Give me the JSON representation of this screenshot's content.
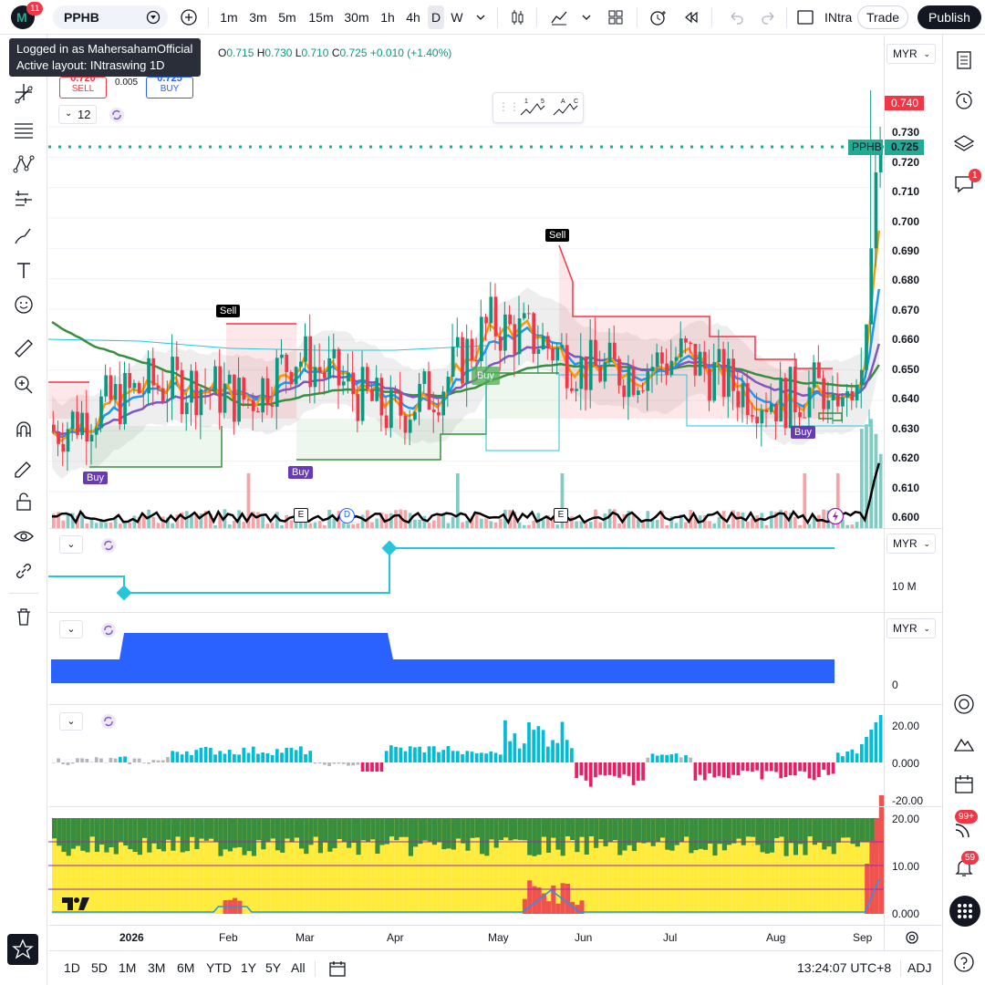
{
  "topbar": {
    "notif_count": "11",
    "symbol": "PPHB",
    "intervals": [
      "1m",
      "3m",
      "5m",
      "15m",
      "30m",
      "1h",
      "4h",
      "D",
      "W"
    ],
    "layout_name": "INtra",
    "trade_label": "Trade",
    "publish_label": "Publish"
  },
  "tooltip": {
    "line1": "Logged in as MahersahamOfficial",
    "line2": "Active layout: INtraswing 1D"
  },
  "legend": {
    "o_label": "O",
    "o_val": "0.715",
    "h_label": "H",
    "h_val": "0.730",
    "l_label": "L",
    "l_val": "0.710",
    "c_label": "C",
    "c_val": "0.725",
    "change": "+0.010 (+1.40%)",
    "sell_price": "0.720",
    "sell_label": "SELL",
    "spread": "0.005",
    "buy_price": "0.725",
    "buy_label": "BUY",
    "indicator_count": "12"
  },
  "main_pane": {
    "currency": "MYR",
    "price_axis": [
      "0.730",
      "0.720",
      "0.710",
      "0.700",
      "0.690",
      "0.680",
      "0.670",
      "0.660",
      "0.650",
      "0.640",
      "0.630",
      "0.620",
      "0.610",
      "0.600"
    ],
    "high_marker": "0.740",
    "symbol_tag": "PPHB",
    "last_price": "0.725",
    "signals": {
      "sell1": "Sell",
      "sell2": "Sell",
      "buy1": "Buy",
      "buy2": "Buy",
      "buy3": "Buy",
      "buy4": "Buy"
    },
    "event_markers": [
      "E",
      "D",
      "E"
    ],
    "elliott_labels": {
      "a": "1",
      "b": "5",
      "c": "A",
      "d": "C"
    }
  },
  "pane2": {
    "currency": "MYR",
    "axis": [
      "10 M"
    ]
  },
  "pane3": {
    "currency": "MYR",
    "axis": [
      "0"
    ]
  },
  "pane4": {
    "axis": [
      "20.00",
      "0.000",
      "-20.00"
    ]
  },
  "pane5": {
    "axis": [
      "20.00",
      "10.00",
      "0.000"
    ]
  },
  "time_axis": [
    "2026",
    "Feb",
    "Mar",
    "Apr",
    "May",
    "Jun",
    "Jul",
    "Aug",
    "Sep"
  ],
  "bottombar": {
    "ranges": [
      "1D",
      "5D",
      "1M",
      "3M",
      "6M",
      "YTD",
      "1Y",
      "5Y",
      "All"
    ],
    "time": "13:24:07 UTC+8",
    "adj": "ADJ"
  },
  "rightbar": {
    "chat_badge": "1",
    "stream_badge": "99+",
    "alerts_badge": "59"
  },
  "colors": {
    "up": "#089981",
    "down": "#f23645",
    "accent": "#2962ff",
    "ema_purple": "#7e57c2",
    "ema_green": "#388e3c",
    "ema_orange": "#ff9800",
    "ema_blue": "#2196f3",
    "last_price_green": "#22ab94"
  },
  "chart_data": {
    "type": "candlestick",
    "symbol": "PPHB",
    "currency": "MYR",
    "interval": "D",
    "ylim": [
      0.598,
      0.745
    ],
    "series": [
      {
        "x": "2025-12-15",
        "close": 0.63
      },
      {
        "x": "2026-01-01",
        "close": 0.638
      },
      {
        "x": "2026-01-15",
        "close": 0.645
      },
      {
        "x": "2026-02-01",
        "close": 0.645
      },
      {
        "x": "2026-02-15",
        "close": 0.64
      },
      {
        "x": "2026-03-01",
        "close": 0.655
      },
      {
        "x": "2026-03-15",
        "close": 0.645
      },
      {
        "x": "2026-04-01",
        "close": 0.635
      },
      {
        "x": "2026-04-15",
        "close": 0.645
      },
      {
        "x": "2026-05-01",
        "close": 0.665
      },
      {
        "x": "2026-05-15",
        "close": 0.66
      },
      {
        "x": "2026-06-01",
        "close": 0.65
      },
      {
        "x": "2026-06-15",
        "close": 0.65
      },
      {
        "x": "2026-07-01",
        "close": 0.655
      },
      {
        "x": "2026-07-15",
        "close": 0.645
      },
      {
        "x": "2026-08-01",
        "close": 0.64
      },
      {
        "x": "2026-08-15",
        "close": 0.645
      },
      {
        "x": "2026-08-20",
        "close": 0.725
      }
    ]
  }
}
